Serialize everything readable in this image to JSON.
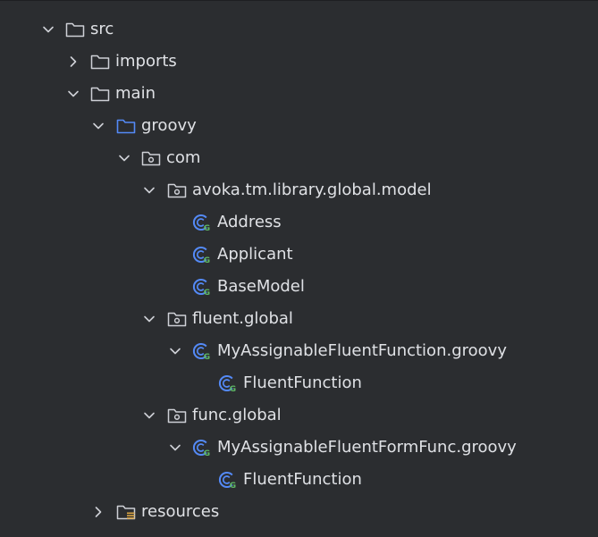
{
  "tree": {
    "items": [
      {
        "label": "src",
        "icon": "folder-icon",
        "state": "expanded"
      },
      {
        "label": "imports",
        "icon": "folder-icon",
        "state": "collapsed"
      },
      {
        "label": "main",
        "icon": "folder-icon",
        "state": "expanded"
      },
      {
        "label": "groovy",
        "icon": "source-root-folder-icon",
        "state": "expanded"
      },
      {
        "label": "com",
        "icon": "package-icon",
        "state": "expanded"
      },
      {
        "label": "avoka.tm.library.global.model",
        "icon": "package-icon",
        "state": "expanded"
      },
      {
        "label": "Address",
        "icon": "groovy-class-icon",
        "state": "leaf"
      },
      {
        "label": "Applicant",
        "icon": "groovy-class-icon",
        "state": "leaf"
      },
      {
        "label": "BaseModel",
        "icon": "groovy-class-icon",
        "state": "leaf"
      },
      {
        "label": "fluent.global",
        "icon": "package-icon",
        "state": "expanded"
      },
      {
        "label": "MyAssignableFluentFunction.groovy",
        "icon": "groovy-class-icon",
        "state": "expanded"
      },
      {
        "label": "FluentFunction",
        "icon": "groovy-class-icon",
        "state": "leaf"
      },
      {
        "label": "func.global",
        "icon": "package-icon",
        "state": "expanded"
      },
      {
        "label": "MyAssignableFluentFormFunc.groovy",
        "icon": "groovy-class-icon",
        "state": "expanded"
      },
      {
        "label": "FluentFunction",
        "icon": "groovy-class-icon",
        "state": "leaf"
      },
      {
        "label": "resources",
        "icon": "resources-folder-icon",
        "state": "collapsed"
      }
    ]
  },
  "colors": {
    "background": "#2b2d30",
    "text": "#dfe1e5",
    "icon_gray": "#ced0d6",
    "source_root_blue": "#548af7",
    "groovy_blue": "#548af7",
    "groovy_green": "#5fb865",
    "resources_yellow": "#d9a343"
  }
}
